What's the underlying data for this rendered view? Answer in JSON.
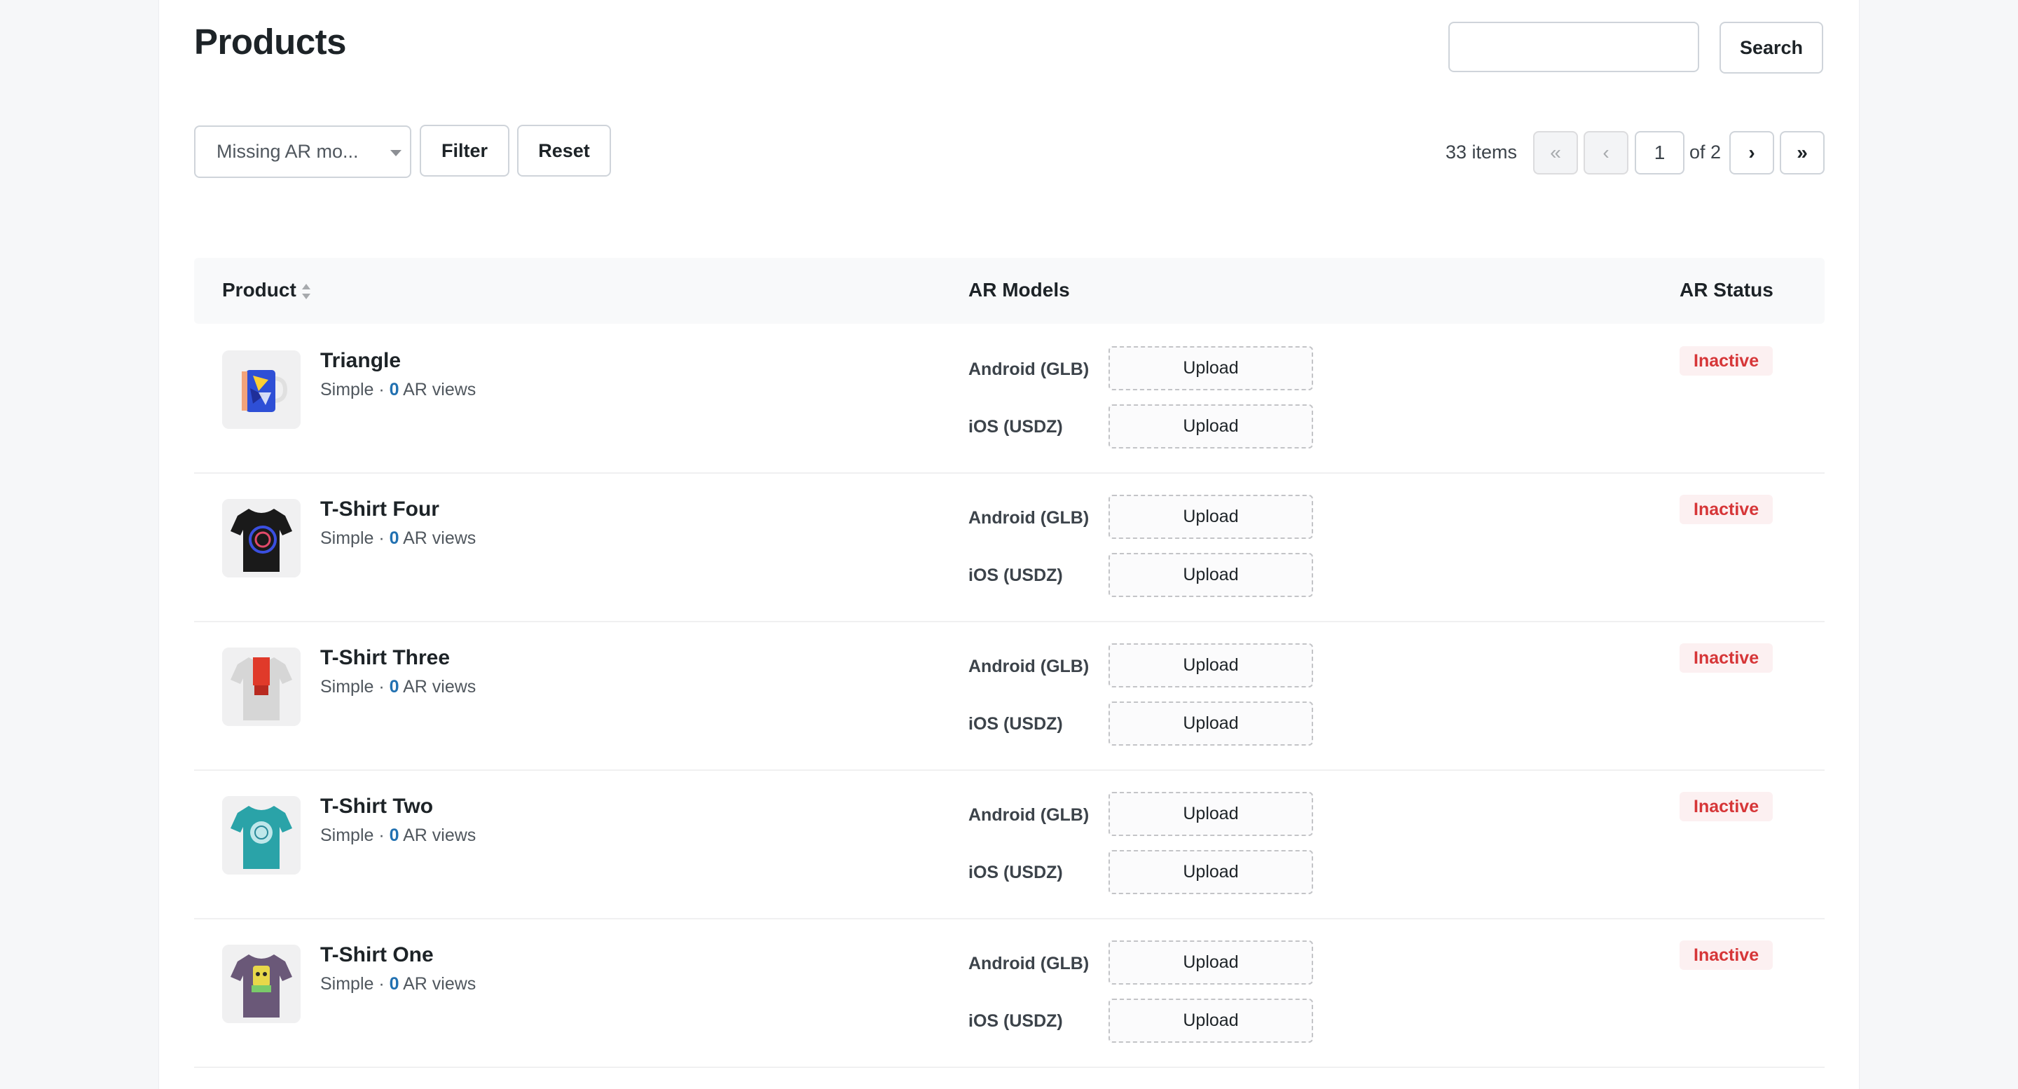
{
  "header": {
    "title": "Products"
  },
  "search": {
    "value": "",
    "placeholder": "",
    "button_label": "Search"
  },
  "filters": {
    "select_value": "Missing AR mo...",
    "filter_label": "Filter",
    "reset_label": "Reset"
  },
  "pagination": {
    "items_count": "33 items",
    "first": "«",
    "prev": "‹",
    "current_page": "1",
    "of_label": "of 2",
    "next": "›",
    "last": "»"
  },
  "table": {
    "headers": {
      "product": "Product",
      "ar_models": "AR Models",
      "ar_status": "AR Status"
    },
    "android_label": "Android (GLB)",
    "ios_label": "iOS (USDZ)",
    "upload_label": "Upload",
    "rows": [
      {
        "name": "Triangle",
        "type": "Simple",
        "sep": " · ",
        "views": "0",
        "views_label": " AR views",
        "status": "Inactive",
        "thumb": "mug-icon"
      },
      {
        "name": "T-Shirt Four",
        "type": "Simple",
        "sep": " · ",
        "views": "0",
        "views_label": " AR views",
        "status": "Inactive",
        "thumb": "tshirt-black-icon"
      },
      {
        "name": "T-Shirt Three",
        "type": "Simple",
        "sep": " · ",
        "views": "0",
        "views_label": " AR views",
        "status": "Inactive",
        "thumb": "tshirt-grey-icon"
      },
      {
        "name": "T-Shirt Two",
        "type": "Simple",
        "sep": " · ",
        "views": "0",
        "views_label": " AR views",
        "status": "Inactive",
        "thumb": "tshirt-teal-icon"
      },
      {
        "name": "T-Shirt One",
        "type": "Simple",
        "sep": " · ",
        "views": "0",
        "views_label": " AR views",
        "status": "Inactive",
        "thumb": "tshirt-purple-icon"
      }
    ]
  },
  "colors": {
    "status_inactive_text": "#d63638",
    "status_inactive_bg": "#fcf0f1",
    "views_accent": "#2271b1"
  }
}
